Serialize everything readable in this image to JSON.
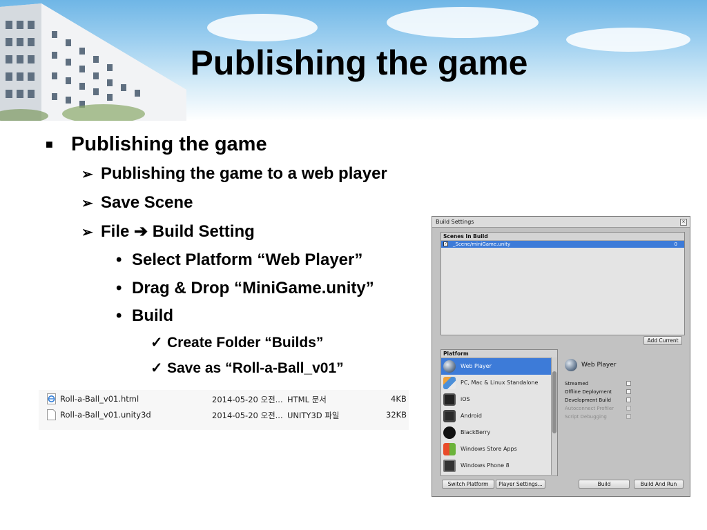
{
  "slide": {
    "title": "Publishing the game",
    "bullets": {
      "l1": "Publishing the game",
      "l2a": "Publishing the game to a web player",
      "l2b": "Save Scene",
      "l2c_file": "File",
      "l2c_arrow": "➔",
      "l2c_rest": "Build Setting",
      "l3a": "Select Platform “Web Player”",
      "l3b": "Drag & Drop “MiniGame.unity”",
      "l3c": "Build",
      "l4a": "Create Folder “Builds”",
      "l4b": "Save as “Roll-a-Ball_v01”"
    },
    "markers": {
      "square": "■",
      "arrow": "➢",
      "dot": "•",
      "check": "✓"
    }
  },
  "files": [
    {
      "name": "Roll-a-Ball_v01.html",
      "date": "2014-05-20 오전...",
      "type": "HTML 문서",
      "size": "4KB",
      "icon": "html-file-icon"
    },
    {
      "name": "Roll-a-Ball_v01.unity3d",
      "date": "2014-05-20 오전...",
      "type": "UNITY3D 파일",
      "size": "32KB",
      "icon": "blank-file-icon"
    }
  ],
  "unity": {
    "window_title": "Build Settings",
    "scenes_header": "Scenes In Build",
    "scene": {
      "name": "_Scene/miniGame.unity",
      "index": "0",
      "checked": true
    },
    "add_current": "Add Current",
    "platform_header": "Platform",
    "platforms": [
      {
        "label": "Web Player",
        "icon": "web-player-icon",
        "selected": true
      },
      {
        "label": "PC, Mac & Linux Standalone",
        "icon": "pc-mac-linux-icon",
        "selected": false
      },
      {
        "label": "iOS",
        "icon": "ios-icon",
        "selected": false
      },
      {
        "label": "Android",
        "icon": "android-icon",
        "selected": false
      },
      {
        "label": "BlackBerry",
        "icon": "blackberry-icon",
        "selected": false
      },
      {
        "label": "Windows Store Apps",
        "icon": "windows-store-icon",
        "selected": false
      },
      {
        "label": "Windows Phone 8",
        "icon": "windows-phone-icon",
        "selected": false
      }
    ],
    "selected_platform_title": "Web Player",
    "options": [
      {
        "label": "Streamed",
        "enabled": true,
        "checked": false
      },
      {
        "label": "Offline Deployment",
        "enabled": true,
        "checked": false
      },
      {
        "label": "Development Build",
        "enabled": true,
        "checked": false
      },
      {
        "label": "Autoconnect Profiler",
        "enabled": false,
        "checked": false
      },
      {
        "label": "Script Debugging",
        "enabled": false,
        "checked": false
      }
    ],
    "buttons": {
      "switch_platform": "Switch Platform",
      "player_settings": "Player Settings...",
      "build": "Build",
      "build_and_run": "Build And Run"
    }
  }
}
